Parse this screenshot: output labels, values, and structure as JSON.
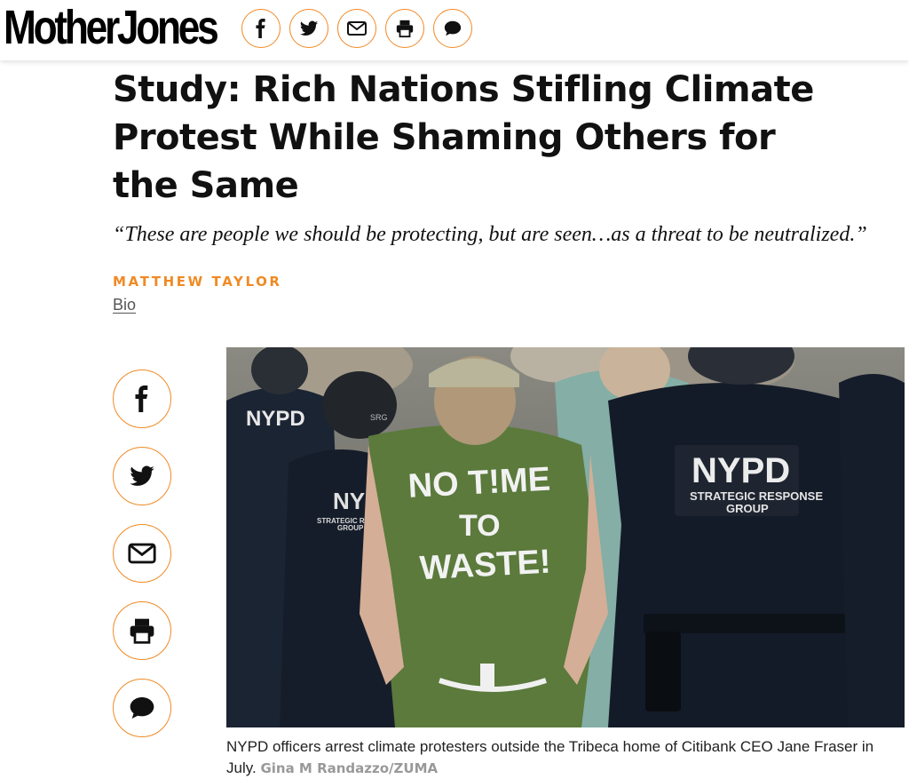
{
  "site": {
    "logo_text": "MotherJones"
  },
  "share": {
    "items": [
      {
        "name": "facebook",
        "icon": "facebook-icon"
      },
      {
        "name": "twitter",
        "icon": "twitter-icon"
      },
      {
        "name": "email",
        "icon": "email-icon"
      },
      {
        "name": "print",
        "icon": "print-icon"
      },
      {
        "name": "comment",
        "icon": "comment-icon"
      }
    ],
    "accent_color": "#f08a24"
  },
  "article": {
    "headline": "Study: Rich Nations Stifling Climate Protest While Shaming Others for the Same",
    "dek": "“These are people we should be protecting, but are seen…as a threat to be neutralized.”",
    "author": "MATTHEW TAYLOR",
    "bio_link": "Bio"
  },
  "photo": {
    "shirt_text_lines": [
      "NO T!ME",
      "TO",
      "WASTE!"
    ],
    "vest_text_left": "NYPD",
    "vest_text_right": "NYPD",
    "vest_sub_right": [
      "STRATEGIC RESPONSE",
      "GROUP"
    ],
    "vest_sub_left": [
      "STRATEGIC RESPONSE",
      "GROUP"
    ],
    "vest_text_mid": "NYPD",
    "helmet_text": "SRG"
  },
  "caption": {
    "text": "NYPD officers arrest climate protesters outside the Tribeca home of Citibank CEO Jane Fraser in July.",
    "credit": "Gina M Randazzo/ZUMA"
  }
}
